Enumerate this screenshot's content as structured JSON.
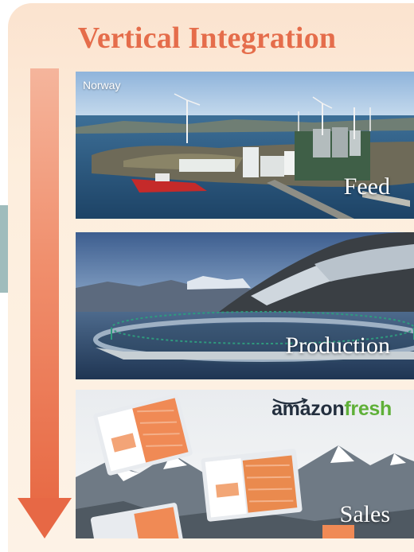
{
  "title": "Vertical Integration",
  "stages": [
    {
      "label": "Feed",
      "region_label": "Norway"
    },
    {
      "label": "Production"
    },
    {
      "label": "Sales",
      "brand_part1": "amazon",
      "brand_part2": "fresh"
    }
  ],
  "colors": {
    "title": "#e56d4b",
    "arrow_top": "#f5b59c",
    "arrow_bottom": "#e86b46",
    "panel": "#fbe3cf",
    "side_tab": "#9fbcbc",
    "brand_dark": "#232f3e",
    "brand_green": "#5fb038"
  }
}
